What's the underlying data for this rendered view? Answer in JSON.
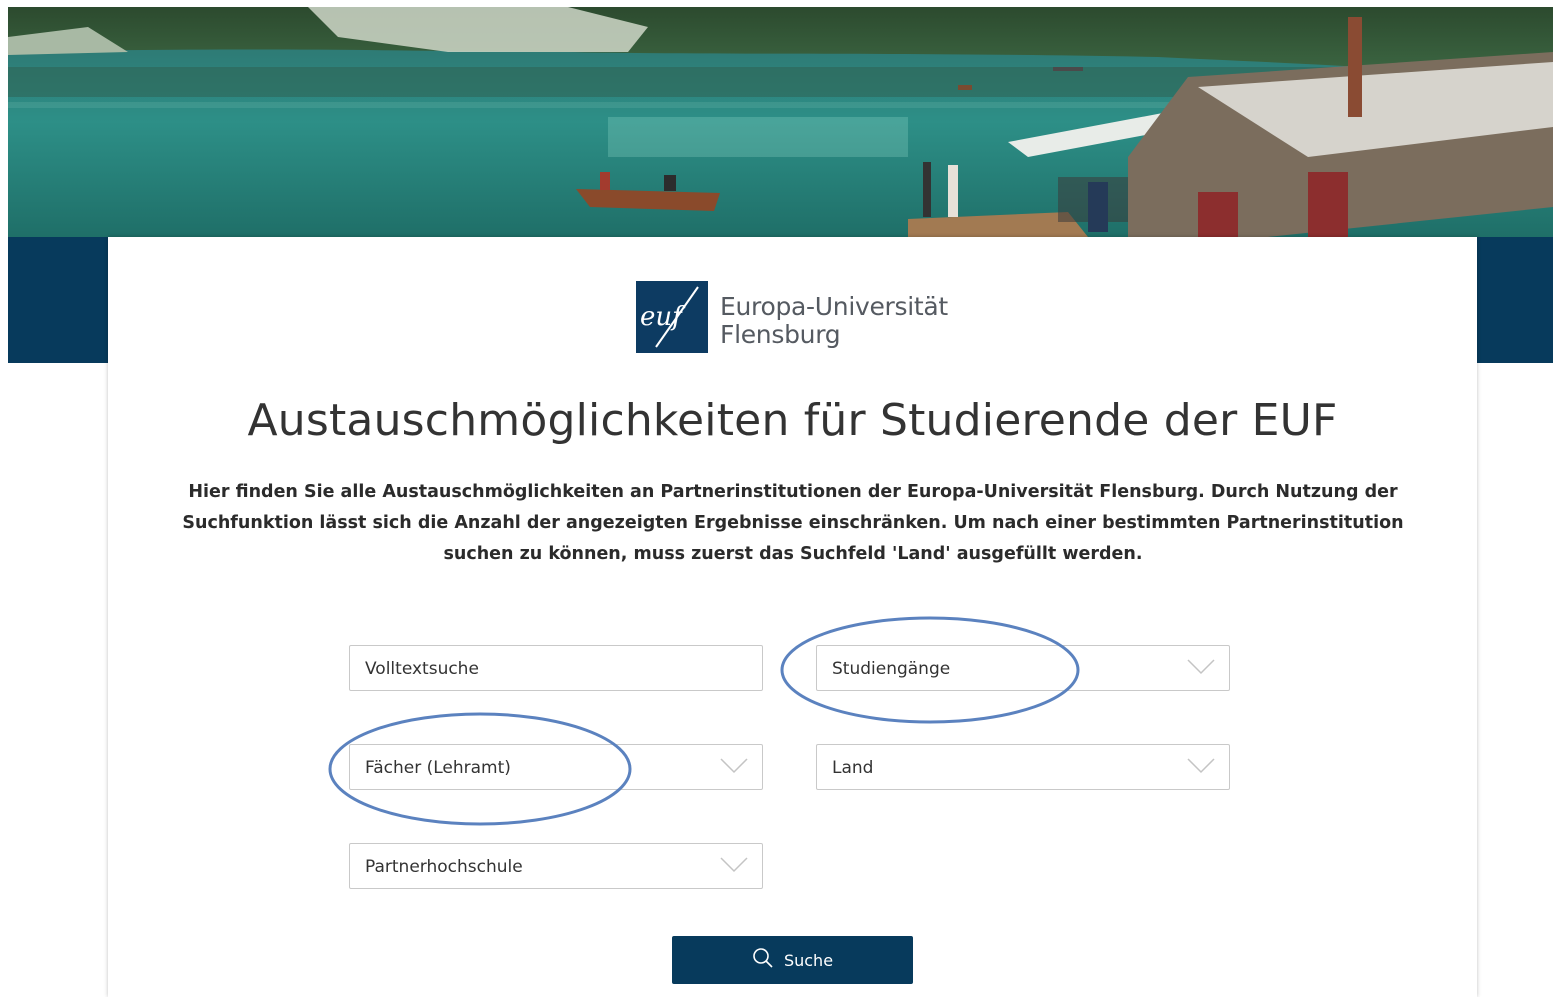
{
  "logo": {
    "mark": "euf",
    "line1": "Europa-Universität",
    "line2": "Flensburg"
  },
  "page": {
    "title": "Austauschmöglichkeiten für Studierende der EUF",
    "intro": "Hier finden Sie alle Austauschmöglichkeiten an Partnerinstitutionen der Europa-Universität Flensburg. Durch Nutzung der Suchfunktion lässt sich die Anzahl der angezeigten Ergebnisse einschränken. Um nach einer bestimmten Partnerinstitution suchen zu können, muss zuerst das Suchfeld 'Land' ausgefüllt werden."
  },
  "search": {
    "fulltext_placeholder": "Volltextsuche",
    "programs_label": "Studiengänge",
    "subjects_label": "Fächer (Lehramt)",
    "country_label": "Land",
    "partner_label": "Partnerhochschule",
    "button_label": "Suche"
  },
  "colors": {
    "navy": "#073a5c",
    "annotation": "#5b82bf"
  },
  "icons": {
    "dropdown": "chevron-down-icon",
    "search": "magnifier-icon"
  }
}
